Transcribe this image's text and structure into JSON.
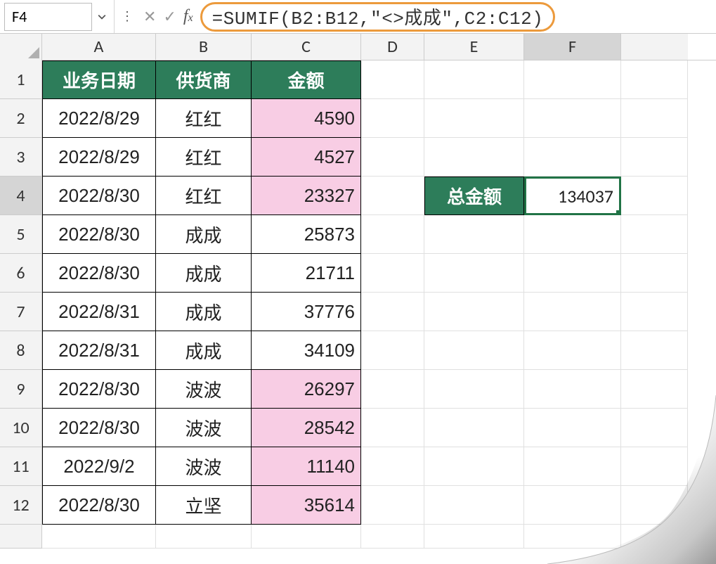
{
  "name_box": "F4",
  "formula": "=SUMIF(B2:B12,\"<>成成\",C2:C12)",
  "columns": [
    "A",
    "B",
    "C",
    "D",
    "E",
    "F"
  ],
  "row_numbers": [
    "1",
    "2",
    "3",
    "4",
    "5",
    "6",
    "7",
    "8",
    "9",
    "10",
    "11",
    "12"
  ],
  "headers": {
    "a": "业务日期",
    "b": "供货商",
    "c": "金额"
  },
  "rows": [
    {
      "date": "2022/8/29",
      "supplier": "红红",
      "amount": "4590",
      "pink": true
    },
    {
      "date": "2022/8/29",
      "supplier": "红红",
      "amount": "4527",
      "pink": true
    },
    {
      "date": "2022/8/30",
      "supplier": "红红",
      "amount": "23327",
      "pink": true
    },
    {
      "date": "2022/8/30",
      "supplier": "成成",
      "amount": "25873",
      "pink": false
    },
    {
      "date": "2022/8/30",
      "supplier": "成成",
      "amount": "21711",
      "pink": false
    },
    {
      "date": "2022/8/31",
      "supplier": "成成",
      "amount": "37776",
      "pink": false
    },
    {
      "date": "2022/8/31",
      "supplier": "成成",
      "amount": "34109",
      "pink": false
    },
    {
      "date": "2022/8/30",
      "supplier": "波波",
      "amount": "26297",
      "pink": true
    },
    {
      "date": "2022/8/30",
      "supplier": "波波",
      "amount": "28542",
      "pink": true
    },
    {
      "date": "2022/9/2",
      "supplier": "波波",
      "amount": "11140",
      "pink": true
    },
    {
      "date": "2022/8/30",
      "supplier": "立坚",
      "amount": "35614",
      "pink": true
    }
  ],
  "total_label": "总金额",
  "total_value": "134037"
}
